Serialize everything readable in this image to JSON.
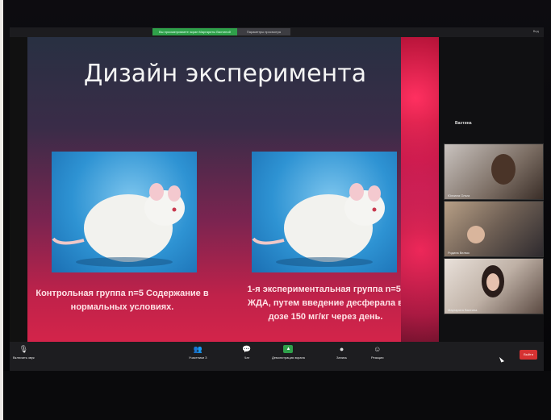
{
  "share_banner": {
    "sharing_label": "Вы просматриваете экран Маргариты Вахтиной",
    "options_label": "Параметры просмотра"
  },
  "view_label": "Вид",
  "slide": {
    "title": "Дизайн эксперимента",
    "left_caption": "Контрольная группа n=5 Содержание в нормальных условиях.",
    "right_caption": "1-я экспериментальная группа n=5; ЖДА, путем введение десферала в дозе 150 мг/кг через день."
  },
  "side_panel": {
    "title": "Вахтина",
    "participants": [
      {
        "name": "Юлиана Ольга"
      },
      {
        "name": "Родина Велмо"
      },
      {
        "name": "Маргарита Вахтина"
      }
    ]
  },
  "toolbar": {
    "left": "Включить звук",
    "participants": "Участники",
    "participants_count": "3",
    "chat": "Чат",
    "share": "Демонстрация экрана",
    "record": "Запись",
    "reactions": "Реакции",
    "end": "Выйти"
  },
  "icons": {
    "mic": "mic-icon",
    "participants": "participants-icon",
    "chat": "chat-icon",
    "share": "share-screen-icon",
    "record": "record-icon",
    "reactions": "reactions-icon"
  },
  "colors": {
    "share_green": "#2fa04a",
    "end_red": "#d63232",
    "slide_red": "#d3244a"
  }
}
